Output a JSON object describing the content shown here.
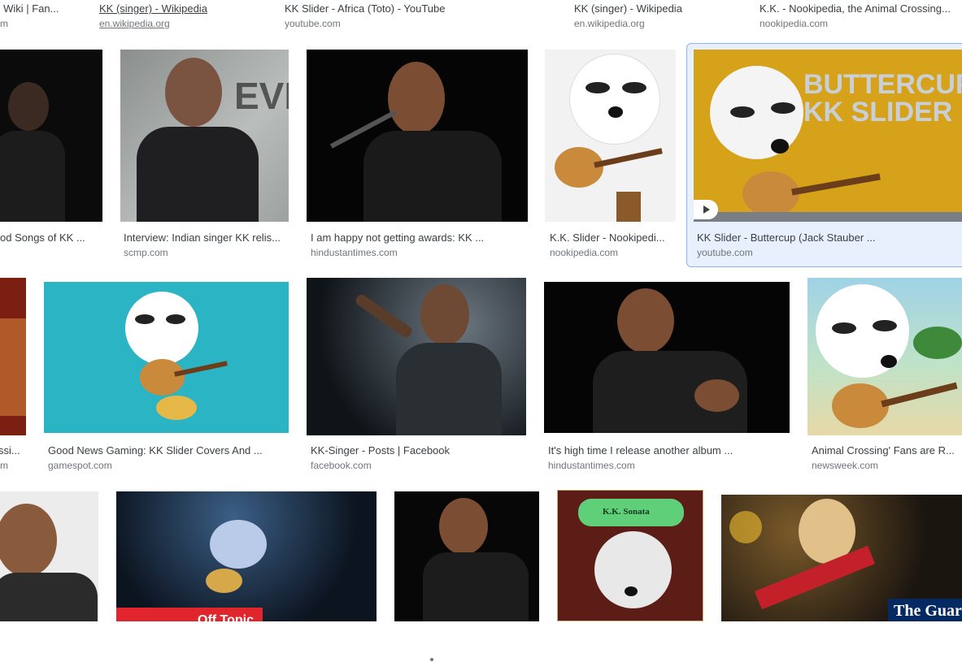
{
  "results": {
    "row0": [
      {
        "title": "ng Wiki | Fan...",
        "source": "m"
      },
      {
        "title": "KK (singer) - Wikipedia",
        "source": "en.wikipedia.org"
      },
      {
        "title": "KK Slider - Africa (Toto) - YouTube",
        "source": "youtube.com"
      },
      {
        "title": "KK (singer) - Wikipedia",
        "source": "en.wikipedia.org"
      },
      {
        "title": "K.K. - Nookipedia, the Animal Crossing...",
        "source": "nookipedia.com"
      }
    ],
    "row1": [
      {
        "title": "od Songs of KK ...",
        "source": ""
      },
      {
        "title": "Interview: Indian singer KK relis...",
        "source": "scmp.com"
      },
      {
        "title": "I am happy not getting awards: KK ...",
        "source": "hindustantimes.com"
      },
      {
        "title": "K.K. Slider - Nookipedi...",
        "source": "nookipedia.com"
      },
      {
        "title": "KK Slider - Buttercup (Jack Stauber ...",
        "source": "youtube.com",
        "thumb_text": "BUTTERCUP KK SLIDER",
        "thumb_text_line1": "BUTTERCUP",
        "thumb_text_line2": "KK SLIDER"
      }
    ],
    "row2": [
      {
        "title": "ssi...",
        "source": "m"
      },
      {
        "title": "Good News Gaming: KK Slider Covers And ...",
        "source": "gamespot.com"
      },
      {
        "title": "KK-Singer - Posts | Facebook",
        "source": "facebook.com"
      },
      {
        "title": "It's high time I release another album ...",
        "source": "hindustantimes.com"
      },
      {
        "title": "Animal Crossing' Fans are R...",
        "source": "newsweek.com"
      }
    ],
    "row3": [
      {
        "thumb_text": ""
      },
      {
        "thumb_text": "Off Topic"
      },
      {
        "thumb_text": ""
      },
      {
        "thumb_text": "K.K. Sonata"
      },
      {
        "thumb_text": "The Guardian"
      }
    ]
  },
  "icons": {
    "play": "play-icon"
  },
  "colors": {
    "title": "#3c4043",
    "source": "#70757a",
    "selected_bg": "#e8f0fe",
    "selected_border": "#8ab4f8",
    "buttercup_yellow": "#d6a21a"
  }
}
